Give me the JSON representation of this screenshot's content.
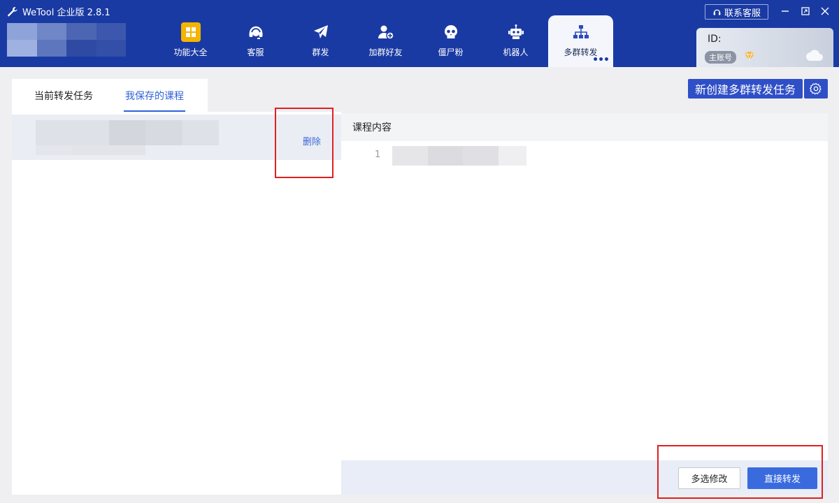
{
  "app": {
    "title": "WeTool 企业版 2.8.1"
  },
  "nav": {
    "items": [
      {
        "label": "功能大全",
        "icon": "grid-icon"
      },
      {
        "label": "客服",
        "icon": "headset-icon"
      },
      {
        "label": "群发",
        "icon": "paper-plane-icon"
      },
      {
        "label": "加群好友",
        "icon": "add-user-icon"
      },
      {
        "label": "僵尸粉",
        "icon": "skull-icon"
      },
      {
        "label": "机器人",
        "icon": "robot-icon"
      },
      {
        "label": "多群转发",
        "icon": "org-chart-icon"
      }
    ],
    "active_index": 6
  },
  "window": {
    "contact_label": "联系客服"
  },
  "account": {
    "id_label": "ID:",
    "badge": "主账号"
  },
  "tabs": {
    "current": "当前转发任务",
    "saved": "我保存的课程"
  },
  "list": {
    "delete_label": "删除"
  },
  "toolbar": {
    "new_task_label": "新创建多群转发任务"
  },
  "content": {
    "header": "课程内容",
    "line_number": "1"
  },
  "actions": {
    "multi_edit_label": "多选修改",
    "direct_forward_label": "直接转发"
  },
  "colors": {
    "header_bg": "#1a3aa3",
    "primary": "#3a6bde",
    "highlight": "#e02020"
  }
}
